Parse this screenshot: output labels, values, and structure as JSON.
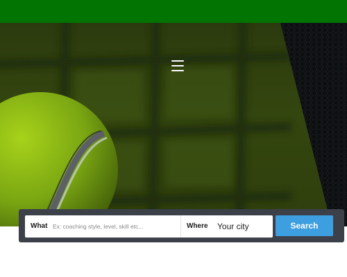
{
  "header": {
    "menu_icon": "hamburger-menu-icon"
  },
  "hero": {
    "image": "tennis-ball-and-net"
  },
  "search": {
    "what_label": "What",
    "what_placeholder": "Ex: coaching style, level, skill etc...",
    "where_label": "Where",
    "where_placeholder": "Your city",
    "button_label": "Search"
  },
  "colors": {
    "top_bar": "#027402",
    "search_bar_bg": "#3c4049",
    "search_button": "#3d9ee0"
  }
}
